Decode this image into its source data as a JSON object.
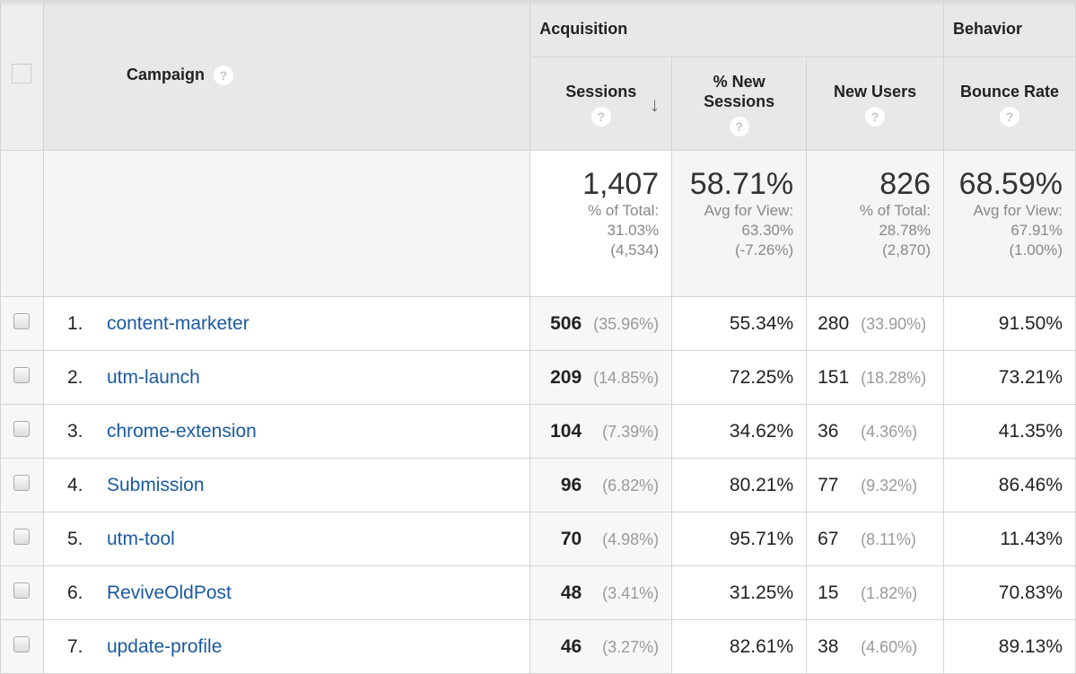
{
  "header": {
    "campaign_label": "Campaign",
    "group_acquisition": "Acquisition",
    "group_behavior": "Behavior",
    "columns": [
      {
        "label": "Sessions",
        "sorted": "descending"
      },
      {
        "label": "% New Sessions"
      },
      {
        "label": "New Users"
      },
      {
        "label": "Bounce Rate"
      }
    ],
    "help_icon": "?",
    "sort_icon": "↓"
  },
  "summary": {
    "sessions": {
      "value": "1,407",
      "line1": "% of Total:",
      "line2": "31.03%",
      "line3": "(4,534)"
    },
    "new_sessions": {
      "value": "58.71%",
      "line1": "Avg for View:",
      "line2": "63.30%",
      "line3": "(-7.26%)"
    },
    "new_users": {
      "value": "826",
      "line1": "% of Total:",
      "line2": "28.78%",
      "line3": "(2,870)"
    },
    "bounce_rate": {
      "value": "68.59%",
      "line1": "Avg for View:",
      "line2": "67.91%",
      "line3": "(1.00%)"
    }
  },
  "rows": [
    {
      "num": "1.",
      "campaign": "content-marketer",
      "sessions": "506",
      "sessions_pct": "(35.96%)",
      "new_sessions": "55.34%",
      "new_users": "280",
      "new_users_pct": "(33.90%)",
      "bounce_rate": "91.50%"
    },
    {
      "num": "2.",
      "campaign": "utm-launch",
      "sessions": "209",
      "sessions_pct": "(14.85%)",
      "new_sessions": "72.25%",
      "new_users": "151",
      "new_users_pct": "(18.28%)",
      "bounce_rate": "73.21%"
    },
    {
      "num": "3.",
      "campaign": "chrome-extension",
      "sessions": "104",
      "sessions_pct": "(7.39%)",
      "new_sessions": "34.62%",
      "new_users": "36",
      "new_users_pct": "(4.36%)",
      "bounce_rate": "41.35%"
    },
    {
      "num": "4.",
      "campaign": "Submission",
      "sessions": "96",
      "sessions_pct": "(6.82%)",
      "new_sessions": "80.21%",
      "new_users": "77",
      "new_users_pct": "(9.32%)",
      "bounce_rate": "86.46%"
    },
    {
      "num": "5.",
      "campaign": "utm-tool",
      "sessions": "70",
      "sessions_pct": "(4.98%)",
      "new_sessions": "95.71%",
      "new_users": "67",
      "new_users_pct": "(8.11%)",
      "bounce_rate": "11.43%"
    },
    {
      "num": "6.",
      "campaign": "ReviveOldPost",
      "sessions": "48",
      "sessions_pct": "(3.41%)",
      "new_sessions": "31.25%",
      "new_users": "15",
      "new_users_pct": "(1.82%)",
      "bounce_rate": "70.83%"
    },
    {
      "num": "7.",
      "campaign": "update-profile",
      "sessions": "46",
      "sessions_pct": "(3.27%)",
      "new_sessions": "82.61%",
      "new_users": "38",
      "new_users_pct": "(4.60%)",
      "bounce_rate": "89.13%"
    }
  ],
  "colors": {
    "link": "#1a5aa0",
    "header_bg": "#e8e8e8",
    "muted": "#888888"
  }
}
